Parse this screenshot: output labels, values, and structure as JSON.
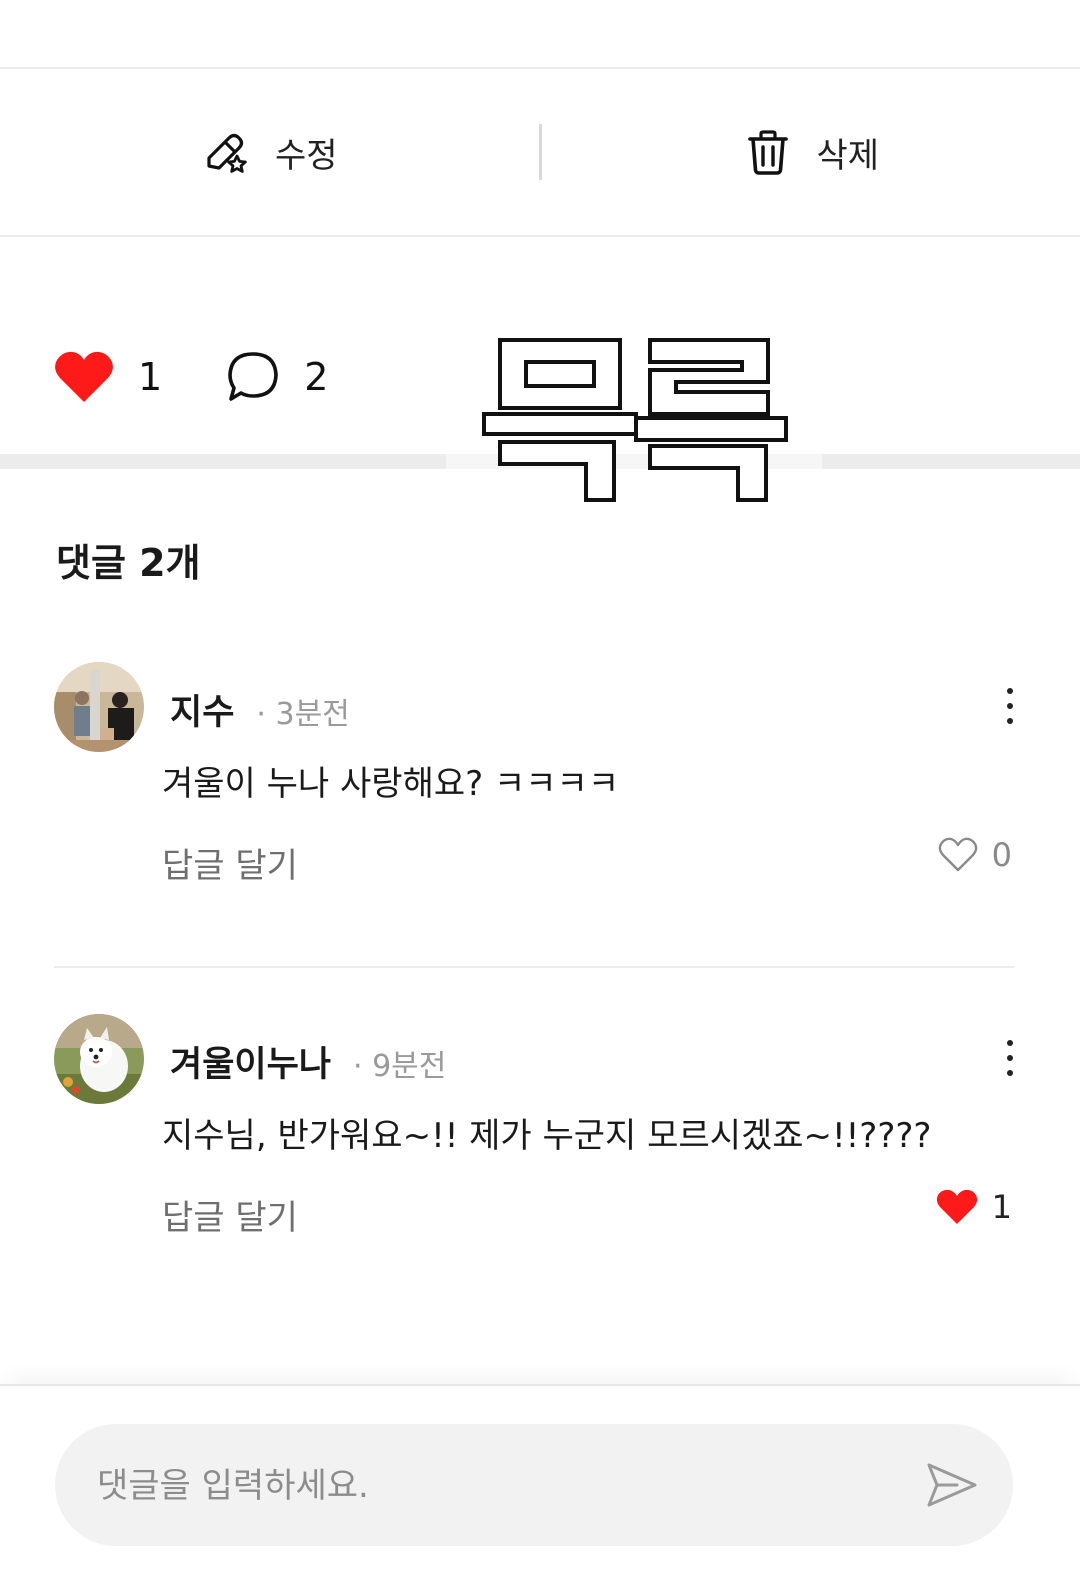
{
  "actions": {
    "edit_label": "수정",
    "delete_label": "삭제"
  },
  "reactions": {
    "like_count": "1",
    "comment_count": "2",
    "like_icon": "heart-filled-icon",
    "comment_icon": "speech-bubble-icon",
    "like_color": "#ff1a1a"
  },
  "stamp": {
    "text": "목록"
  },
  "comments_section": {
    "count_label": "댓글 2개"
  },
  "comments": [
    {
      "author": "지수",
      "time": "· 3분전",
      "text": "겨울이 누나 사랑해요? ㅋㅋㅋㅋ",
      "reply_label": "답글 달기",
      "like_count": "0",
      "liked": false
    },
    {
      "author": "겨울이누나",
      "time": "· 9분전",
      "text": "지수님, 반가워요~!! 제가 누군지 모르시겠죠~!!????",
      "reply_label": "답글 달기",
      "like_count": "1",
      "liked": true
    }
  ],
  "input": {
    "placeholder": "댓글을 입력하세요."
  },
  "colors": {
    "accent_red": "#ff1a1a",
    "muted_text": "#9a9a9a",
    "divider": "#ececec",
    "input_bg": "#f2f2f2"
  }
}
